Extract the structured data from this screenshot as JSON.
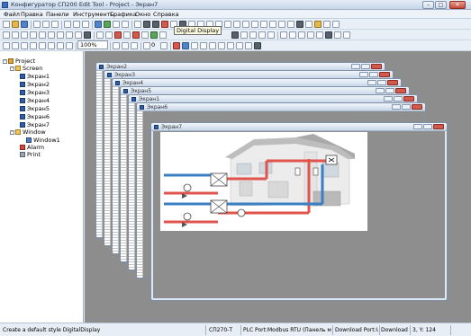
{
  "window": {
    "title": "Конфигуратор СП200 Edit Tool - Project - Экран7"
  },
  "menu": [
    "Файл",
    "Правка",
    "Панели",
    "Инструменты",
    "Графика",
    "Окно",
    "Справка"
  ],
  "tooltip": "Digital Display",
  "zoom": {
    "value": "100%"
  },
  "line_width_value": "0",
  "tree": {
    "root": "Project",
    "screen_group": "Screen",
    "screens": [
      "Экран1",
      "Экран2",
      "Экран3",
      "Экран4",
      "Экран5",
      "Экран6",
      "Экран7"
    ],
    "window_group": "Window",
    "windows": [
      "Window1"
    ],
    "alarm": "Alarm",
    "print": "Print"
  },
  "screen_windows": [
    "Экран2",
    "Экран3",
    "Экран4",
    "Экран5",
    "Экран1",
    "Экран6",
    "Экран7"
  ],
  "status": {
    "hint": "Create a default style DigitalDisplay",
    "device": "СП270-Т",
    "port": "PLC Port:Modbus RTU (Панель мас",
    "download": "Download Port:Unuse",
    "download2": "Download Port",
    "coords": "3, Y: 124"
  },
  "colors": {
    "pipe_hot": "#e0544c",
    "pipe_cold": "#3a7fc4",
    "canvas_bg": "#8d8d8d"
  }
}
